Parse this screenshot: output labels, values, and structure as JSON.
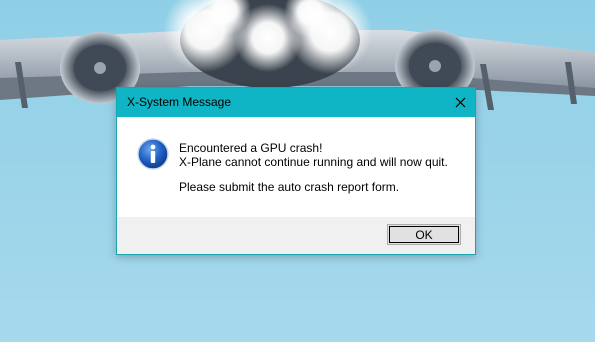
{
  "dialog": {
    "title": "X-System Message",
    "close_icon": "close-icon",
    "message_icon": "info-icon",
    "lines": [
      "Encountered a GPU crash!",
      "X-Plane cannot continue running and will now quit.",
      "Please submit the auto crash report form."
    ],
    "ok_label": "OK"
  },
  "colors": {
    "titlebar": "#0fb5c4",
    "sky": "#9ad3e9",
    "info_icon_blue": "#1f5fc4"
  }
}
